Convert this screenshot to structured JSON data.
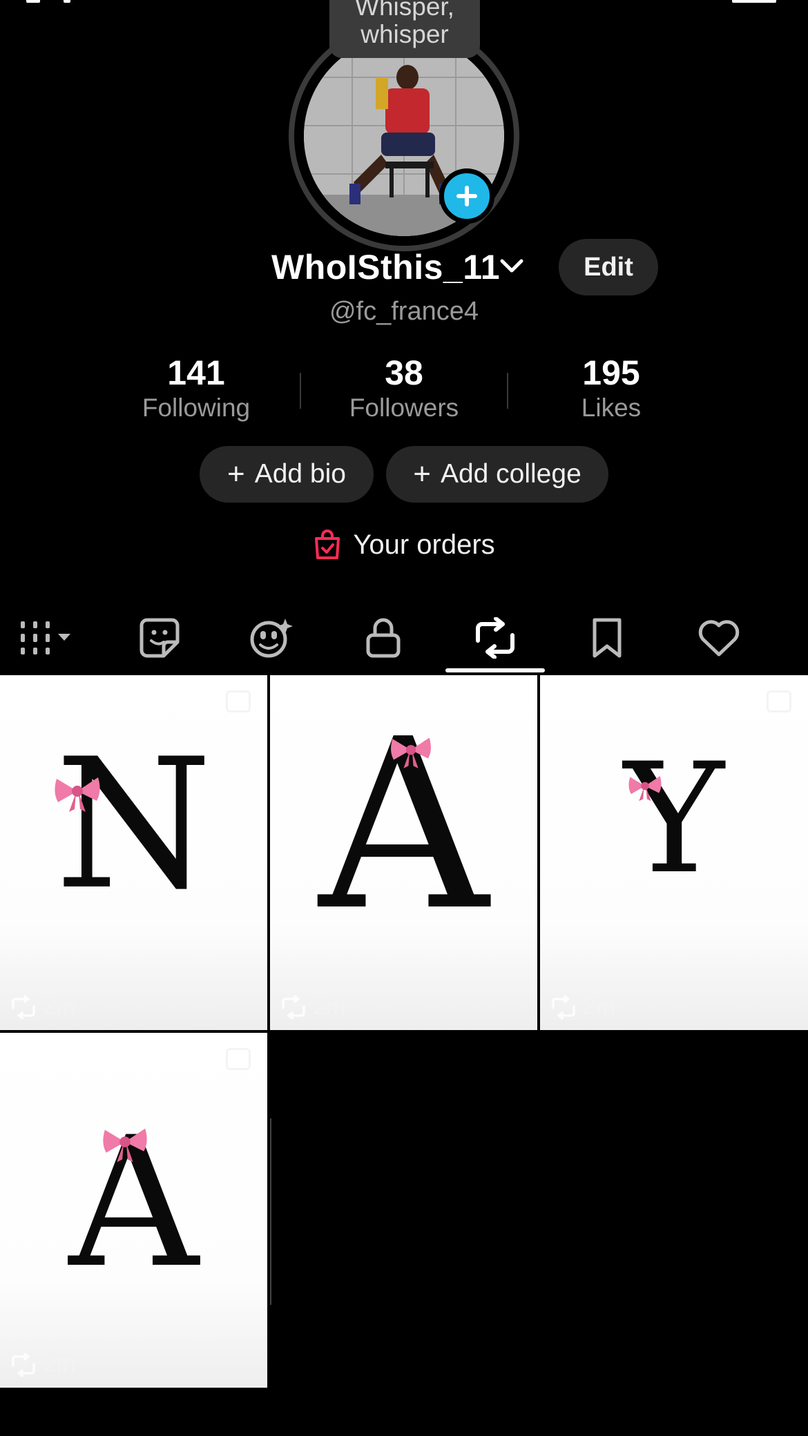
{
  "tooltip": {
    "line1": "Whisper,",
    "line2": "whisper"
  },
  "profile": {
    "username": "WhoISthis_11",
    "handle": "@fc_france4",
    "edit_label": "Edit"
  },
  "stats": [
    {
      "value": "141",
      "label": "Following"
    },
    {
      "value": "38",
      "label": "Followers"
    },
    {
      "value": "195",
      "label": "Likes"
    }
  ],
  "actions": {
    "add_bio": "Add bio",
    "add_college": "Add college",
    "orders": "Your orders"
  },
  "tabs": [
    "videos-grid",
    "sticker",
    "face-effects",
    "private-lock",
    "reposts",
    "bookmarks",
    "liked"
  ],
  "active_tab": "reposts",
  "posts": [
    {
      "letter": "N",
      "time": "2m"
    },
    {
      "letter": "A",
      "time": "2m"
    },
    {
      "letter": "Y",
      "time": "2m"
    },
    {
      "letter": "A",
      "time": "2m"
    }
  ],
  "colors": {
    "accent_blue": "#20b8e8",
    "orders_red": "#fe2c55",
    "bow_pink": "#f07aa8"
  }
}
